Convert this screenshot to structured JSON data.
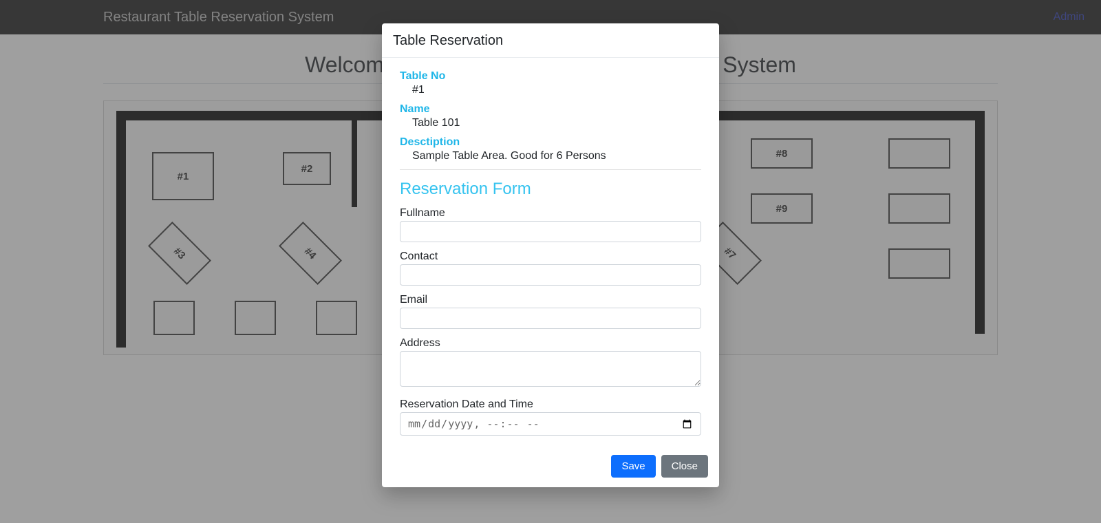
{
  "navbar": {
    "brand": "Restaurant Table Reservation System",
    "admin_link": "Admin"
  },
  "page": {
    "welcome_title": "Welcome to Restaurant Table Reservation System"
  },
  "floorplan": {
    "tables": {
      "t1": "#1",
      "t2": "#2",
      "t3": "#3",
      "t4": "#4",
      "t7": "#7",
      "t8": "#8",
      "t9": "#9"
    }
  },
  "modal": {
    "title": "Table Reservation",
    "info": {
      "table_no_label": "Table No",
      "table_no_value": "#1",
      "name_label": "Name",
      "name_value": "Table 101",
      "description_label": "Desctiption",
      "description_value": "Sample Table Area. Good for 6 Persons"
    },
    "form": {
      "section_title": "Reservation Form",
      "fullname_label": "Fullname",
      "fullname_value": "",
      "contact_label": "Contact",
      "contact_value": "",
      "email_label": "Email",
      "email_value": "",
      "address_label": "Address",
      "address_value": "",
      "datetime_label": "Reservation Date and Time",
      "datetime_placeholder": "mm/dd/yyyy --:-- --",
      "datetime_value": ""
    },
    "footer": {
      "save_label": "Save",
      "close_label": "Close"
    }
  }
}
